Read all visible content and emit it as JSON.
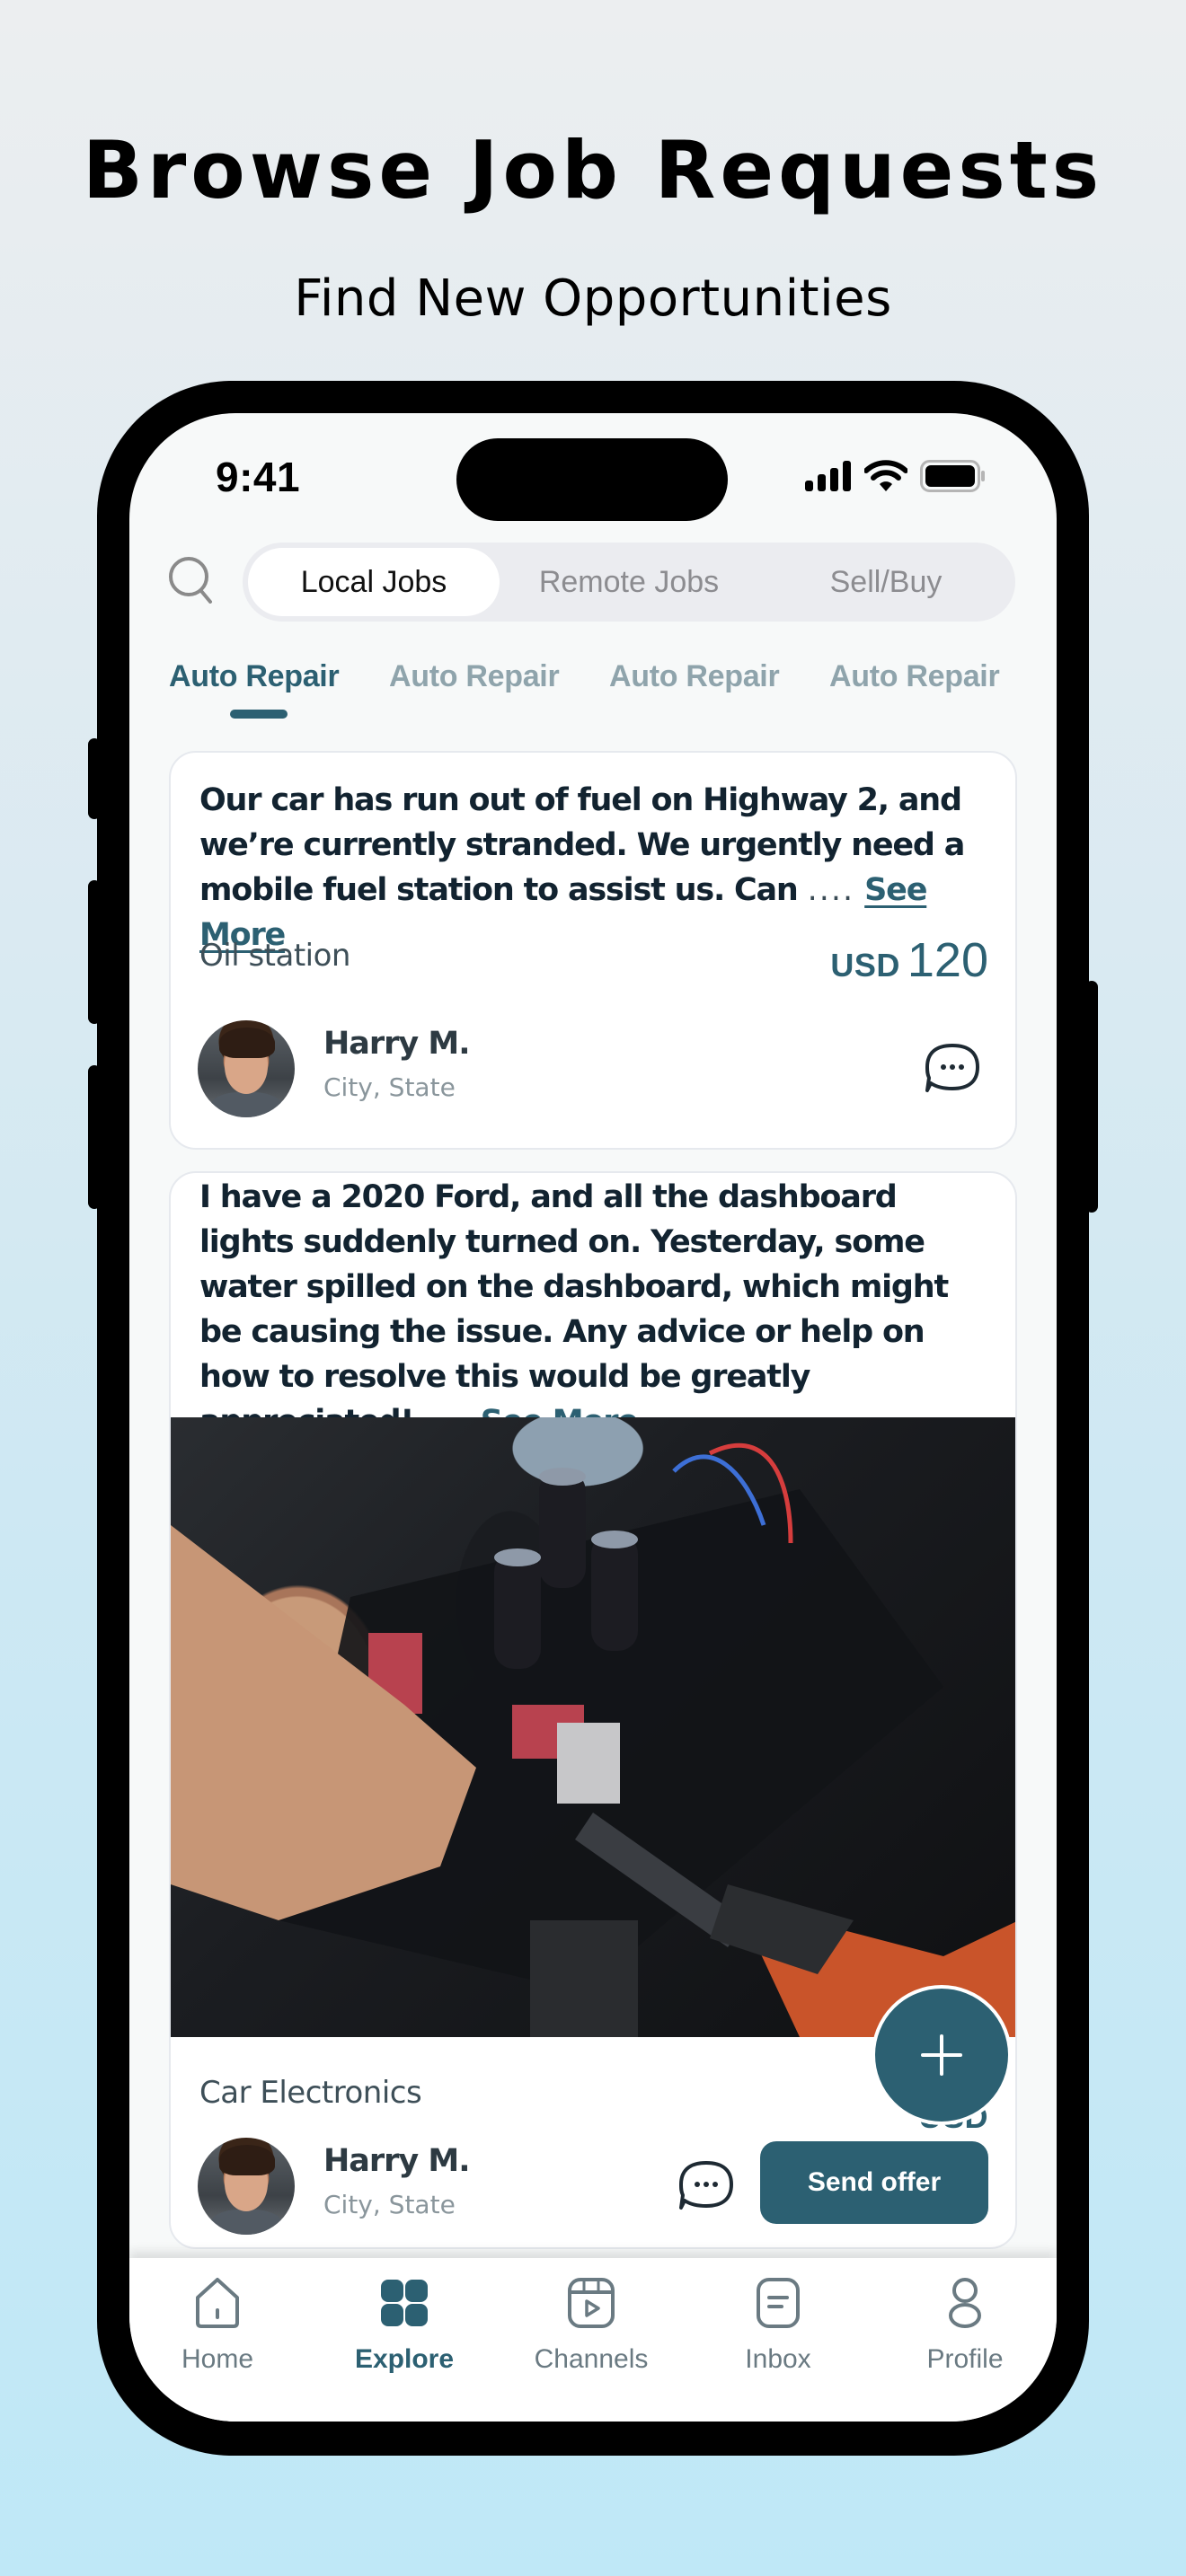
{
  "hero": {
    "title": "Browse Job Requests",
    "subtitle": "Find New Opportunities"
  },
  "status_bar": {
    "time": "9:41"
  },
  "segmented_control": {
    "items": [
      {
        "label": "Local Jobs",
        "active": true
      },
      {
        "label": "Remote Jobs",
        "active": false
      },
      {
        "label": "Sell/Buy",
        "active": false
      }
    ]
  },
  "category_tabs": [
    {
      "label": "Auto Repair",
      "active": true
    },
    {
      "label": "Auto Repair",
      "active": false
    },
    {
      "label": "Auto Repair",
      "active": false
    },
    {
      "label": "Auto Repair",
      "active": false
    }
  ],
  "jobs": [
    {
      "description": "Our car has run out of fuel on Highway 2, and we’re currently stranded. We urgently need a mobile fuel station to assist us. Can",
      "ellipsis": "....",
      "see_more": "See More",
      "category": "Oil station",
      "currency": "USD",
      "amount": "120",
      "user_name": "Harry M.",
      "user_location": "City, State"
    },
    {
      "description": "I have a 2020 Ford, and all the dashboard lights suddenly turned on. Yesterday, some water spilled on the dashboard, which might be causing the issue. Any advice or help on how to resolve this would be greatly appreciated!",
      "ellipsis": "....",
      "see_more": "See More",
      "image_alt": "Hand working on circuit board with screwdriver",
      "category": "Car Electronics",
      "currency": "USD",
      "user_name": "Harry M.",
      "user_location": "City, State",
      "action_label": "Send offer"
    }
  ],
  "fab": {
    "icon": "plus-icon"
  },
  "bottom_nav": [
    {
      "label": "Home",
      "icon": "home-icon",
      "active": false
    },
    {
      "label": "Explore",
      "icon": "explore-grid-icon",
      "active": true
    },
    {
      "label": "Channels",
      "icon": "channels-play-icon",
      "active": false
    },
    {
      "label": "Inbox",
      "icon": "inbox-icon",
      "active": false
    },
    {
      "label": "Profile",
      "icon": "profile-icon",
      "active": false
    }
  ],
  "colors": {
    "accent": "#2c6072",
    "text_dark": "#122330",
    "inactive_tab": "#8fa4ac",
    "nav_inactive": "#6a7a82"
  }
}
